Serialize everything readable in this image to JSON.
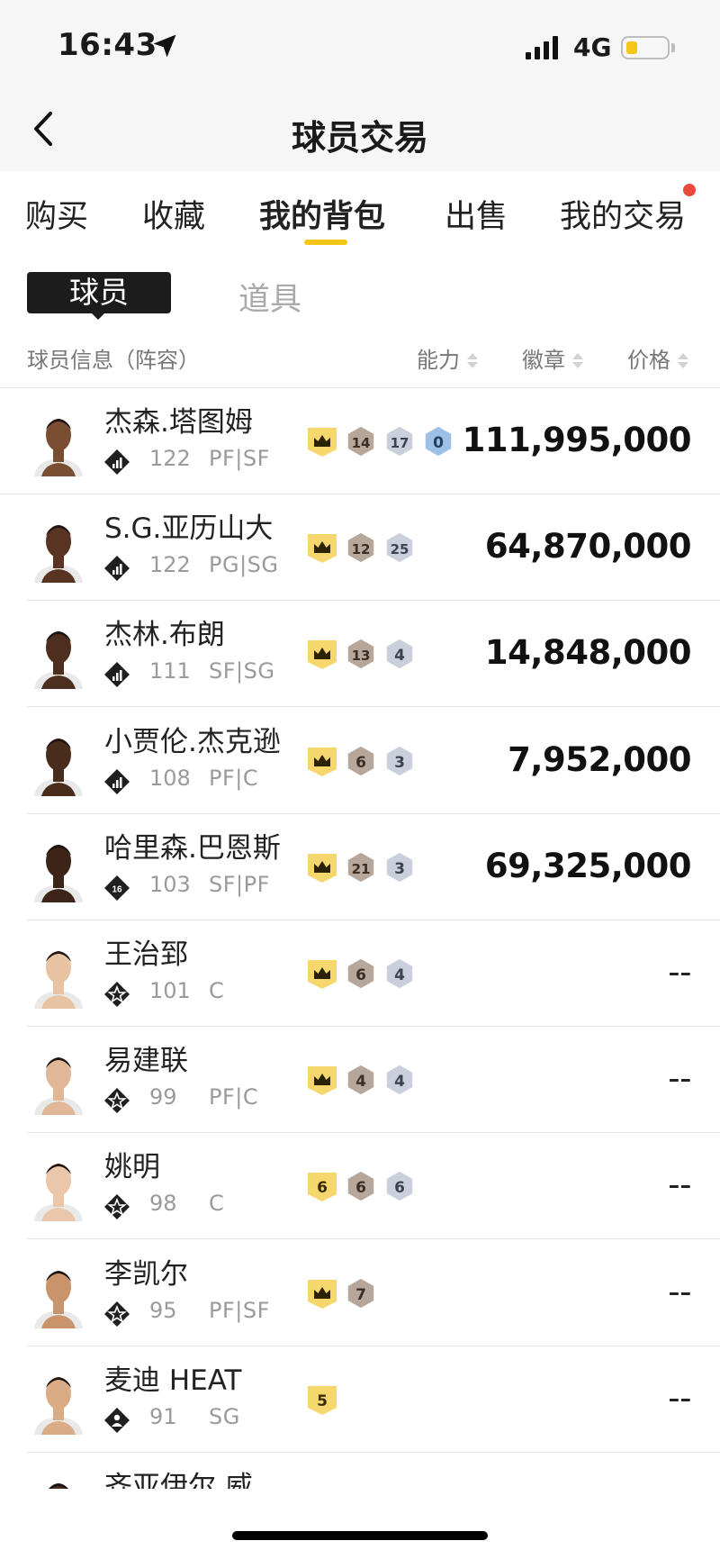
{
  "status_bar": {
    "time": "16:43",
    "network": "4G"
  },
  "header": {
    "title": "球员交易",
    "back_icon": "chevron-left-icon"
  },
  "tabs": [
    {
      "label": "购买",
      "active": false
    },
    {
      "label": "收藏",
      "active": false
    },
    {
      "label": "我的背包",
      "active": true
    },
    {
      "label": "出售",
      "active": false
    },
    {
      "label": "我的交易",
      "active": false,
      "notification_dot": true
    }
  ],
  "segments": {
    "active": "球员",
    "other": "道具"
  },
  "table_header": {
    "info": "球员信息（阵容）",
    "ability": "能力",
    "badges": "徽章",
    "price": "价格"
  },
  "players": [
    {
      "name": "杰森.塔图姆",
      "rating": "122",
      "position": "PF|SF",
      "rank_icon": "bar-chart-rank-icon",
      "badges": [
        {
          "type": "gold",
          "text": "crown"
        },
        {
          "type": "bronze",
          "text": "14"
        },
        {
          "type": "silver",
          "text": "17"
        },
        {
          "type": "blue",
          "text": "0"
        }
      ],
      "price": "111,995,000",
      "skin": "#7a4e33"
    },
    {
      "name": "S.G.亚历山大",
      "rating": "122",
      "position": "PG|SG",
      "rank_icon": "bar-chart-rank-icon",
      "badges": [
        {
          "type": "gold",
          "text": "crown"
        },
        {
          "type": "bronze",
          "text": "12"
        },
        {
          "type": "silver",
          "text": "25"
        }
      ],
      "price": "64,870,000",
      "skin": "#5a3422"
    },
    {
      "name": "杰林.布朗",
      "rating": "111",
      "position": "SF|SG",
      "rank_icon": "bar-chart-rank-icon",
      "badges": [
        {
          "type": "gold",
          "text": "crown"
        },
        {
          "type": "bronze",
          "text": "13"
        },
        {
          "type": "silver",
          "text": "4"
        }
      ],
      "price": "14,848,000",
      "skin": "#4e2f1f"
    },
    {
      "name": "小贾伦.杰克逊",
      "rating": "108",
      "position": "PF|C",
      "rank_icon": "bar-chart-rank-icon",
      "badges": [
        {
          "type": "gold",
          "text": "crown"
        },
        {
          "type": "bronze",
          "text": "6"
        },
        {
          "type": "silver",
          "text": "3"
        }
      ],
      "price": "7,952,000",
      "skin": "#4a2c1c"
    },
    {
      "name": "哈里森.巴恩斯",
      "rating": "103",
      "position": "SF|PF",
      "rank_icon": "number-16-rank-icon",
      "badges": [
        {
          "type": "gold",
          "text": "crown"
        },
        {
          "type": "bronze",
          "text": "21"
        },
        {
          "type": "silver",
          "text": "3"
        }
      ],
      "price": "69,325,000",
      "skin": "#3d2418"
    },
    {
      "name": "王治郅",
      "rating": "101",
      "position": "C",
      "rank_icon": "star-rank-icon",
      "badges": [
        {
          "type": "gold",
          "text": "crown"
        },
        {
          "type": "bronze",
          "text": "6"
        },
        {
          "type": "silver",
          "text": "4"
        }
      ],
      "price": "--",
      "skin": "#e8c3a3"
    },
    {
      "name": "易建联",
      "rating": "99",
      "position": "PF|C",
      "rank_icon": "star-rank-icon",
      "badges": [
        {
          "type": "gold",
          "text": "crown"
        },
        {
          "type": "bronze",
          "text": "4"
        },
        {
          "type": "silver",
          "text": "4"
        }
      ],
      "price": "--",
      "skin": "#e0b898"
    },
    {
      "name": "姚明",
      "rating": "98",
      "position": "C",
      "rank_icon": "star-rank-icon",
      "badges": [
        {
          "type": "gold",
          "text": "6"
        },
        {
          "type": "bronze",
          "text": "6"
        },
        {
          "type": "silver",
          "text": "6"
        }
      ],
      "price": "--",
      "skin": "#eac7aa"
    },
    {
      "name": "李凯尔",
      "rating": "95",
      "position": "PF|SF",
      "rank_icon": "star-rank-icon",
      "badges": [
        {
          "type": "gold",
          "text": "crown"
        },
        {
          "type": "bronze",
          "text": "7"
        }
      ],
      "price": "--",
      "skin": "#c9946b"
    },
    {
      "name": "麦迪 HEAT",
      "rating": "91",
      "position": "SG",
      "rank_icon": "person-rank-icon",
      "badges": [
        {
          "type": "gold",
          "text": "5"
        }
      ],
      "price": "--",
      "skin": "#d9ac86"
    },
    {
      "name": "齐亚伊尔.威",
      "rating": "",
      "position": "",
      "rank_icon": "",
      "badges": [],
      "price": "",
      "skin": "#4a2c1c",
      "partial": true
    }
  ],
  "colors": {
    "accent": "#f5c518",
    "notification": "#e94a3c",
    "badge_gold": "#f5d76e",
    "badge_bronze": "#b7a79b",
    "badge_silver": "#c9d0dc",
    "badge_blue": "#9cc0e6"
  }
}
